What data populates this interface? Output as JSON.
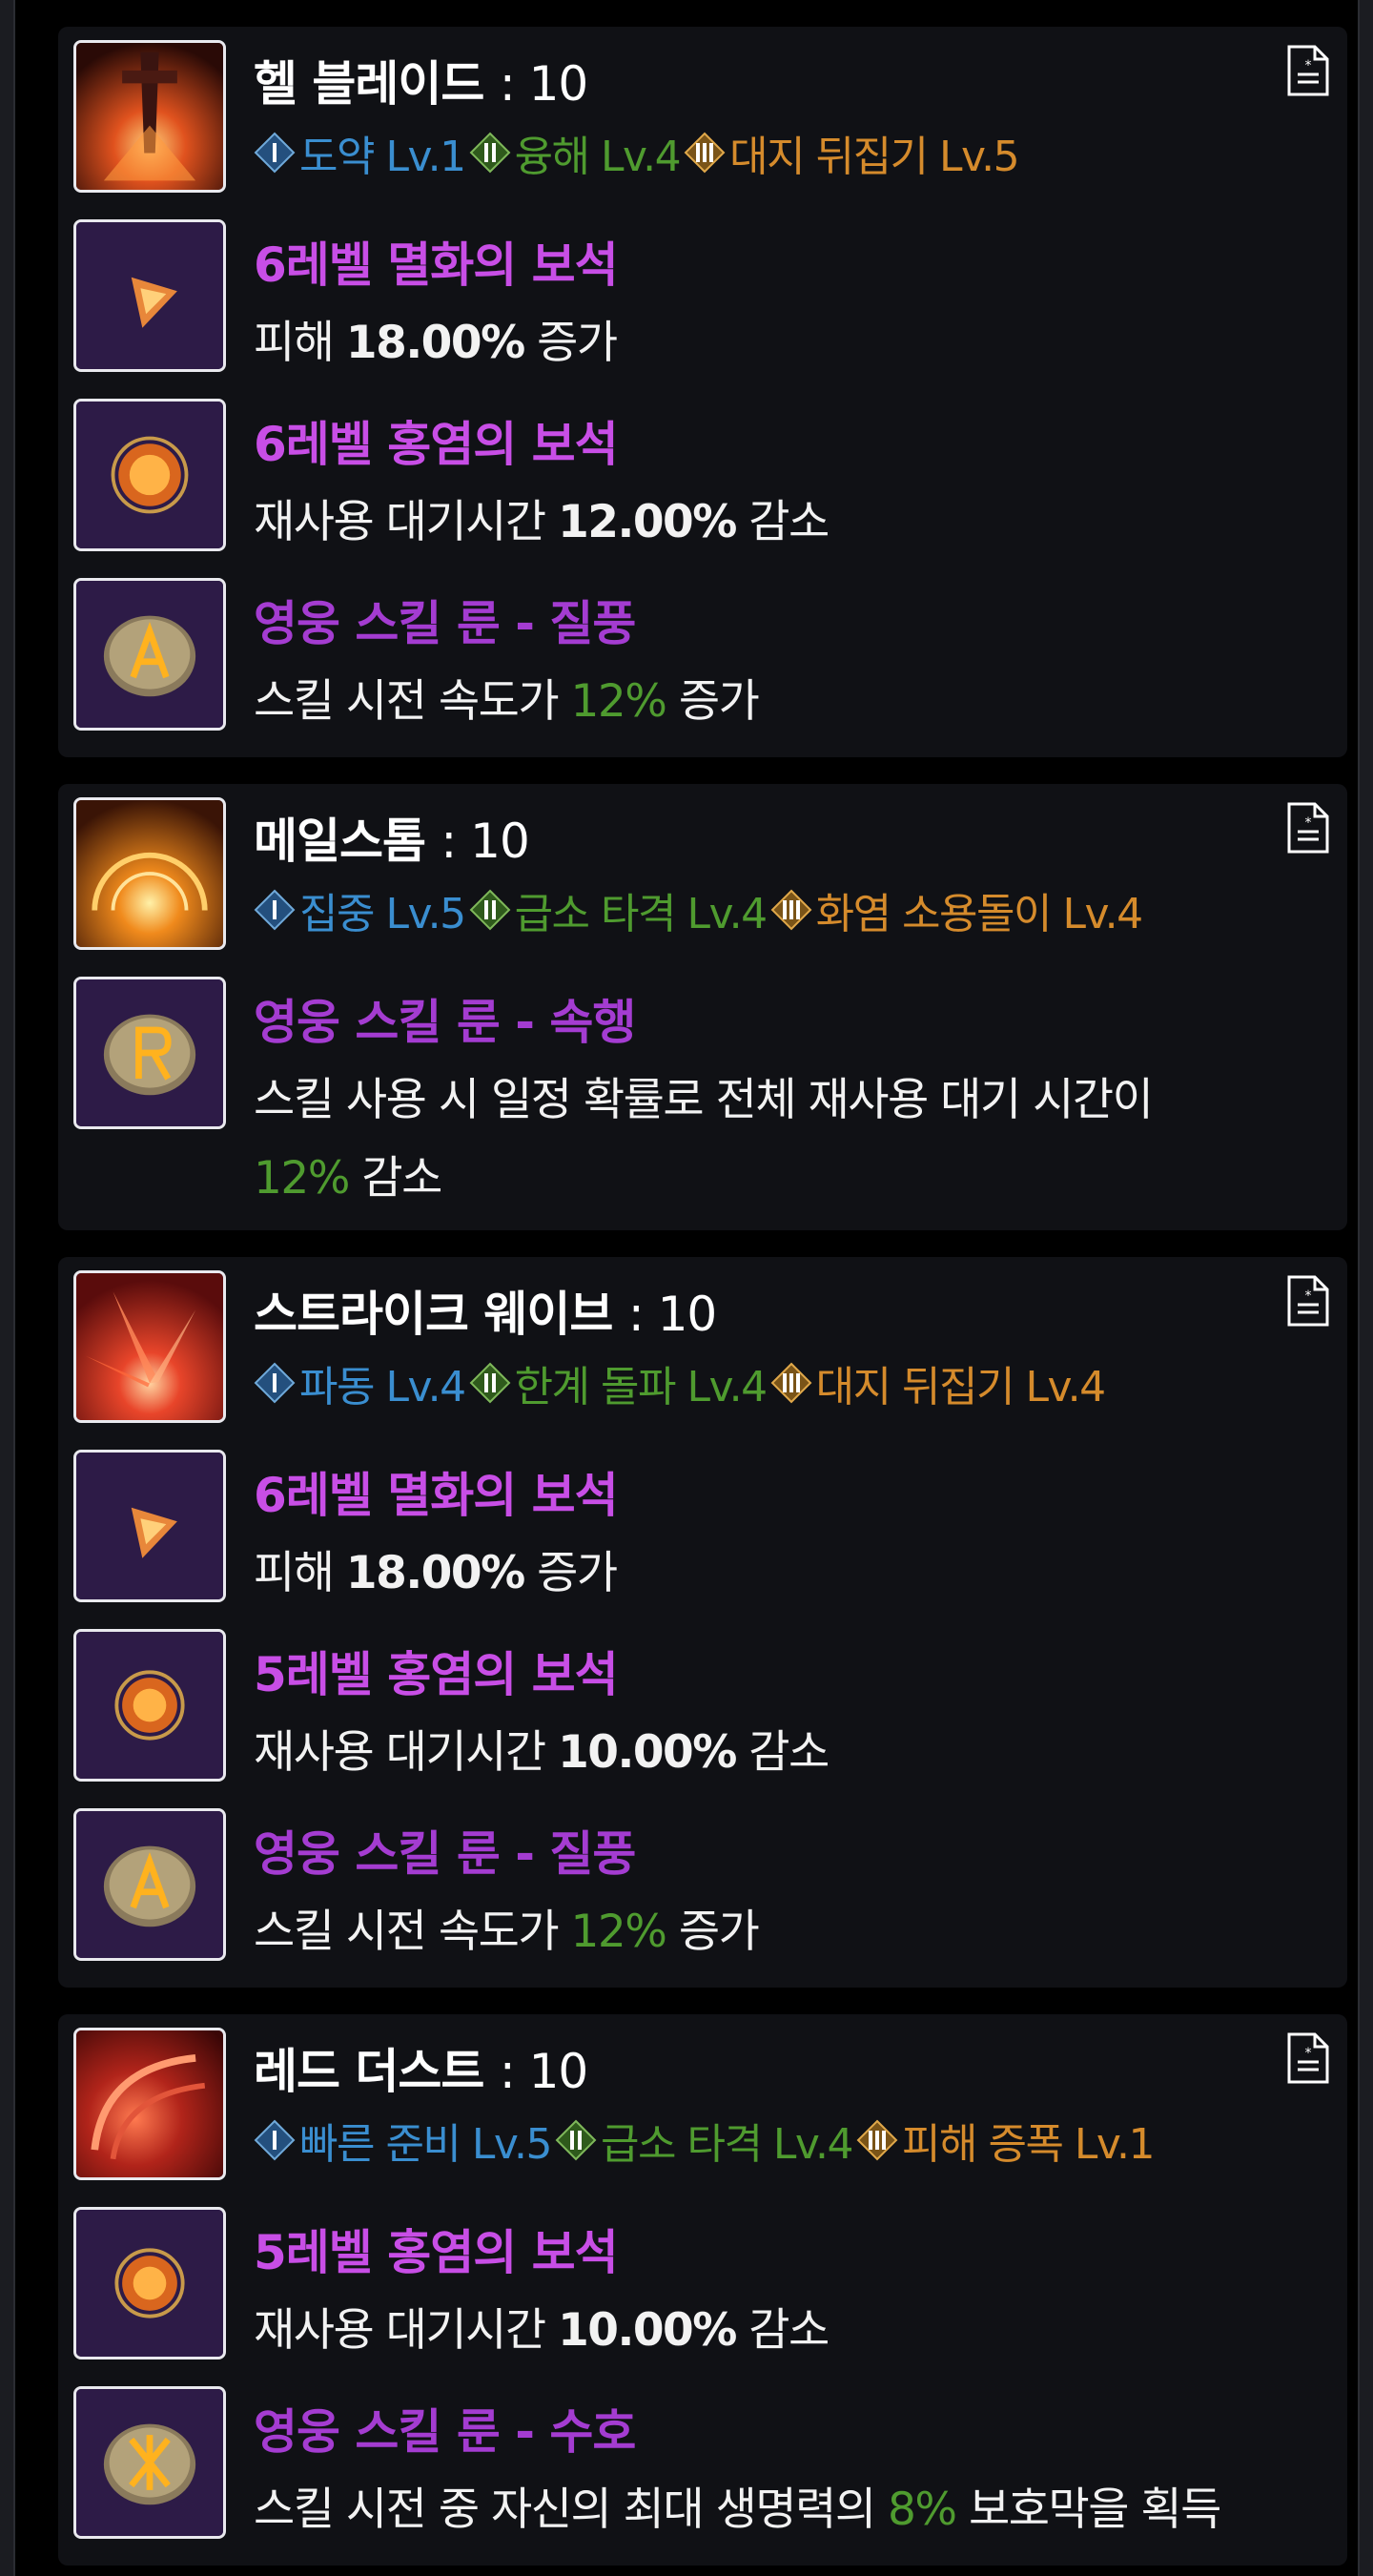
{
  "skills": [
    {
      "name": "헬 블레이드",
      "level": "10",
      "icon": "hell-blade-icon",
      "tripods": [
        {
          "label": "도약 Lv.1",
          "tier": "I"
        },
        {
          "label": "융해 Lv.4",
          "tier": "II"
        },
        {
          "label": "대지 뒤집기 Lv.5",
          "tier": "III"
        }
      ],
      "items": [
        {
          "type": "gem",
          "name": "6레벨 멸화의 보석",
          "pre": "피해 ",
          "value": "18.00%",
          "post": " 증가",
          "icon": "doom-gem-icon"
        },
        {
          "type": "gem",
          "name": "6레벨 홍염의 보석",
          "pre": "재사용 대기시간 ",
          "value": "12.00%",
          "post": " 감소",
          "icon": "crimson-gem-icon"
        },
        {
          "type": "rune",
          "name": "영웅 스킬 룬 - 질풍",
          "pre": "스킬 시전 속도가 ",
          "value": "12%",
          "post": " 증가",
          "icon": "gale-rune-icon"
        }
      ]
    },
    {
      "name": "메일스톰",
      "level": "10",
      "icon": "maelstrom-icon",
      "tripods": [
        {
          "label": "집중 Lv.5",
          "tier": "I"
        },
        {
          "label": "급소 타격 Lv.4",
          "tier": "II"
        },
        {
          "label": "화염 소용돌이 Lv.4",
          "tier": "III"
        }
      ],
      "items": [
        {
          "type": "rune",
          "name": "영웅 스킬 룬 - 속행",
          "line1": "스킬 사용 시 일정 확률로 전체 재사용 대기 시간이",
          "value": "12%",
          "post": " 감소",
          "icon": "haste-rune-icon"
        }
      ]
    },
    {
      "name": "스트라이크 웨이브",
      "level": "10",
      "icon": "strike-wave-icon",
      "tripods": [
        {
          "label": "파동 Lv.4",
          "tier": "I"
        },
        {
          "label": "한계 돌파 Lv.4",
          "tier": "II"
        },
        {
          "label": "대지 뒤집기 Lv.4",
          "tier": "III"
        }
      ],
      "items": [
        {
          "type": "gem",
          "name": "6레벨 멸화의 보석",
          "pre": "피해 ",
          "value": "18.00%",
          "post": " 증가",
          "icon": "doom-gem-icon"
        },
        {
          "type": "gem",
          "name": "5레벨 홍염의 보석",
          "pre": "재사용 대기시간 ",
          "value": "10.00%",
          "post": " 감소",
          "icon": "crimson-gem-icon"
        },
        {
          "type": "rune",
          "name": "영웅 스킬 룬 - 질풍",
          "pre": "스킬 시전 속도가 ",
          "value": "12%",
          "post": " 증가",
          "icon": "gale-rune-icon"
        }
      ]
    },
    {
      "name": "레드 더스트",
      "level": "10",
      "icon": "red-dust-icon",
      "tripods": [
        {
          "label": "빠른 준비 Lv.5",
          "tier": "I"
        },
        {
          "label": "급소 타격 Lv.4",
          "tier": "II"
        },
        {
          "label": "피해 증폭 Lv.1",
          "tier": "III"
        }
      ],
      "items": [
        {
          "type": "gem",
          "name": "5레벨 홍염의 보석",
          "pre": "재사용 대기시간 ",
          "value": "10.00%",
          "post": " 감소",
          "icon": "crimson-gem-icon"
        },
        {
          "type": "rune",
          "name": "영웅 스킬 룬 - 수호",
          "pre": "스킬 시전 중 자신의 최대 생명력의 ",
          "value": "8%",
          "post": " 보호막을 획득",
          "icon": "guard-rune-icon"
        }
      ]
    }
  ]
}
